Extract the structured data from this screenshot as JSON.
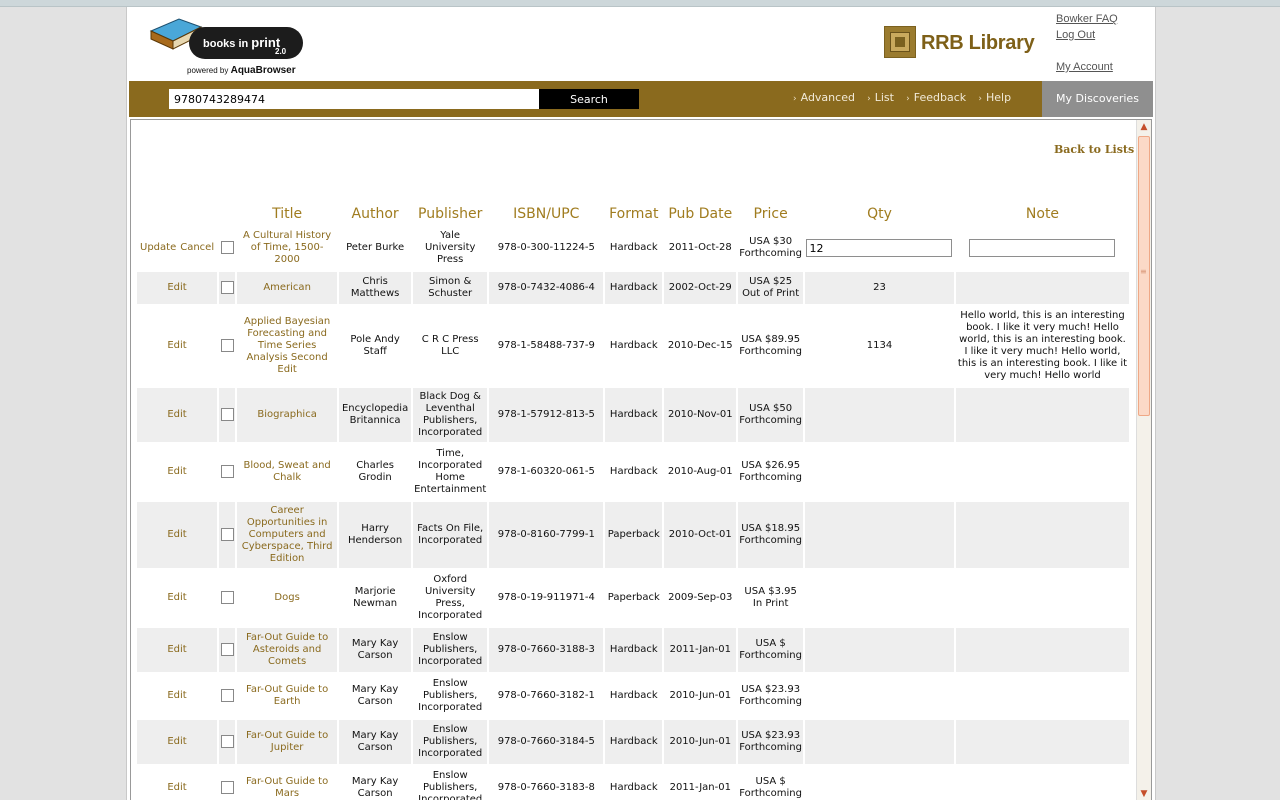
{
  "header": {
    "logo_books": "books in",
    "logo_print": "print",
    "logo_version": "2.0",
    "logo_powered": "powered by",
    "logo_powered_brand": "AquaBrowser",
    "library_name": "RRB Library",
    "links": {
      "faq": "Bowker FAQ",
      "logout": "Log Out",
      "account": "My Account"
    }
  },
  "search": {
    "value": "9780743289474",
    "button": "Search"
  },
  "nav": {
    "items": [
      "Advanced",
      "List",
      "Feedback",
      "Help"
    ],
    "my_discoveries": "My Discoveries"
  },
  "back_link": "Back to Lists",
  "table": {
    "columns": [
      "Title",
      "Author",
      "Publisher",
      "ISBN/UPC",
      "Format",
      "Pub Date",
      "Price",
      "Qty",
      "Note"
    ],
    "edit_row": {
      "update": "Update",
      "cancel": "Cancel",
      "title": "A Cultural History of Time, 1500-2000",
      "author": "Peter Burke",
      "publisher": "Yale University Press",
      "isbn": "978-0-300-11224-5",
      "format": "Hardback",
      "pub_date": "2011-Oct-28",
      "price": "USA $30 Forthcoming",
      "qty": "12",
      "note": ""
    },
    "edit_label": "Edit",
    "rows": [
      {
        "title": "American",
        "author": "Chris Matthews",
        "publisher": "Simon & Schuster",
        "isbn": "978-0-7432-4086-4",
        "format": "Hardback",
        "pub_date": "2002-Oct-29",
        "price": "USA $25 Out of Print",
        "qty": "23",
        "note": ""
      },
      {
        "title": "Applied Bayesian Forecasting and Time Series Analysis Second Edit",
        "author": "Pole Andy Staff",
        "publisher": "C R C Press LLC",
        "isbn": "978-1-58488-737-9",
        "format": "Hardback",
        "pub_date": "2010-Dec-15",
        "price": "USA $89.95 Forthcoming",
        "qty": "1134",
        "note": "Hello world, this is an interesting book. I like it very much! Hello world, this is an interesting book. I like it very much! Hello world, this is an interesting book. I like it very much! Hello world"
      },
      {
        "title": "Biographica",
        "author": "Encyclopedia Britannica",
        "publisher": "Black Dog & Leventhal Publishers, Incorporated",
        "isbn": "978-1-57912-813-5",
        "format": "Hardback",
        "pub_date": "2010-Nov-01",
        "price": "USA $50 Forthcoming",
        "qty": "",
        "note": ""
      },
      {
        "title": "Blood, Sweat and Chalk",
        "author": "Charles Grodin",
        "publisher": "Time, Incorporated Home Entertainment",
        "isbn": "978-1-60320-061-5",
        "format": "Hardback",
        "pub_date": "2010-Aug-01",
        "price": "USA $26.95 Forthcoming",
        "qty": "",
        "note": ""
      },
      {
        "title": "Career Opportunities in Computers and Cyberspace, Third Edition",
        "author": "Harry Henderson",
        "publisher": "Facts On File, Incorporated",
        "isbn": "978-0-8160-7799-1",
        "format": "Paperback",
        "pub_date": "2010-Oct-01",
        "price": "USA $18.95 Forthcoming",
        "qty": "",
        "note": ""
      },
      {
        "title": "Dogs",
        "author": "Marjorie Newman",
        "publisher": "Oxford University Press, Incorporated",
        "isbn": "978-0-19-911971-4",
        "format": "Paperback",
        "pub_date": "2009-Sep-03",
        "price": "USA $3.95 In Print",
        "qty": "",
        "note": ""
      },
      {
        "title": "Far-Out Guide to Asteroids and Comets",
        "author": "Mary Kay Carson",
        "publisher": "Enslow Publishers, Incorporated",
        "isbn": "978-0-7660-3188-3",
        "format": "Hardback",
        "pub_date": "2011-Jan-01",
        "price": "USA $ Forthcoming",
        "qty": "",
        "note": ""
      },
      {
        "title": "Far-Out Guide to Earth",
        "author": "Mary Kay Carson",
        "publisher": "Enslow Publishers, Incorporated",
        "isbn": "978-0-7660-3182-1",
        "format": "Hardback",
        "pub_date": "2010-Jun-01",
        "price": "USA $23.93 Forthcoming",
        "qty": "",
        "note": ""
      },
      {
        "title": "Far-Out Guide to Jupiter",
        "author": "Mary Kay Carson",
        "publisher": "Enslow Publishers, Incorporated",
        "isbn": "978-0-7660-3184-5",
        "format": "Hardback",
        "pub_date": "2010-Jun-01",
        "price": "USA $23.93 Forthcoming",
        "qty": "",
        "note": ""
      },
      {
        "title": "Far-Out Guide to Mars",
        "author": "Mary Kay Carson",
        "publisher": "Enslow Publishers, Incorporated",
        "isbn": "978-0-7660-3183-8",
        "format": "Hardback",
        "pub_date": "2011-Jan-01",
        "price": "USA $ Forthcoming",
        "qty": "",
        "note": ""
      }
    ]
  },
  "colors": {
    "accent": "#8a6a1e",
    "heading": "#a07c1f",
    "row_alt": "#eeeeee",
    "discoveries": "#8f8f8f"
  }
}
